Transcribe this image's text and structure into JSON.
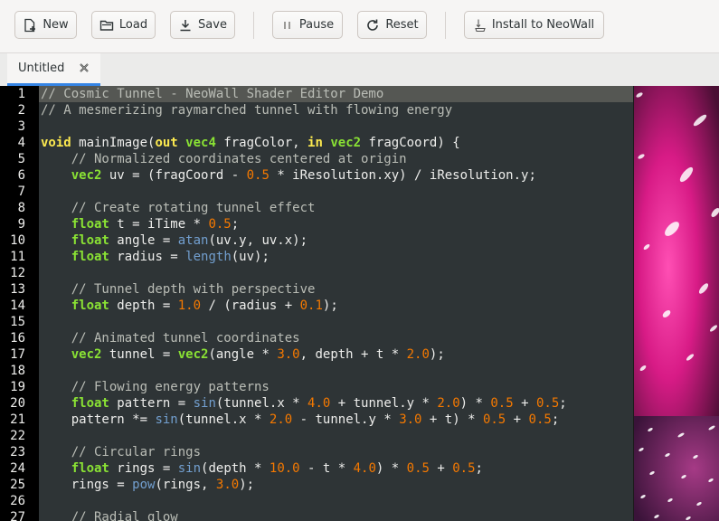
{
  "toolbar": {
    "new_label": "New",
    "load_label": "Load",
    "save_label": "Save",
    "pause_label": "Pause",
    "reset_label": "Reset",
    "install_label": "Install to NeoWall"
  },
  "tabs": [
    {
      "label": "Untitled",
      "active": true
    }
  ],
  "editor": {
    "current_line": 1,
    "line_numbers": [
      "1",
      "2",
      "3",
      "4",
      "5",
      "6",
      "7",
      "8",
      "9",
      "10",
      "11",
      "12",
      "13",
      "14",
      "15",
      "16",
      "17",
      "18",
      "19",
      "20",
      "21",
      "22",
      "23",
      "24",
      "25",
      "26",
      "27"
    ],
    "code_lines": [
      "// Cosmic Tunnel - NeoWall Shader Editor Demo",
      "// A mesmerizing raymarched tunnel with flowing energy",
      "",
      "void mainImage(out vec4 fragColor, in vec2 fragCoord) {",
      "    // Normalized coordinates centered at origin",
      "    vec2 uv = (fragCoord - 0.5 * iResolution.xy) / iResolution.y;",
      "",
      "    // Create rotating tunnel effect",
      "    float t = iTime * 0.5;",
      "    float angle = atan(uv.y, uv.x);",
      "    float radius = length(uv);",
      "",
      "    // Tunnel depth with perspective",
      "    float depth = 1.0 / (radius + 0.1);",
      "",
      "    // Animated tunnel coordinates",
      "    vec2 tunnel = vec2(angle * 3.0, depth + t * 2.0);",
      "",
      "    // Flowing energy patterns",
      "    float pattern = sin(tunnel.x * 4.0 + tunnel.y * 2.0) * 0.5 + 0.5;",
      "    pattern *= sin(tunnel.x * 2.0 - tunnel.y * 3.0 + t) * 0.5 + 0.5;",
      "",
      "    // Circular rings",
      "    float rings = sin(depth * 10.0 - t * 4.0) * 0.5 + 0.5;",
      "    rings = pow(rings, 3.0);",
      "",
      "    // Radial glow"
    ]
  },
  "colors": {
    "accent": "#3584e4",
    "editor_bg": "#2e3436",
    "gutter_bg": "#000000",
    "current_line_bg": "#555753",
    "comment": "#babdb6",
    "keyword": "#fce94f",
    "type": "#8ae234",
    "number": "#f57900",
    "function": "#729fcf",
    "preview_magenta": "#d6167a"
  },
  "icons": {
    "new": "document-new-icon",
    "load": "folder-open-icon",
    "save": "download-icon",
    "pause": "pause-icon",
    "reset": "reload-icon",
    "install": "install-icon",
    "tab_close": "close-icon"
  }
}
